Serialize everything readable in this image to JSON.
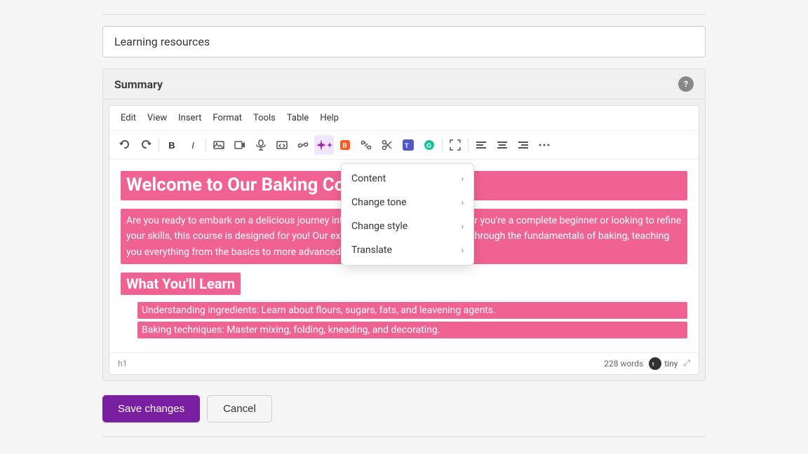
{
  "page": {
    "title": "Learning resources",
    "summary_label": "Summary",
    "help_icon": "?",
    "word_count": "228 words",
    "status_tag": "h1",
    "tiny_label": "tiny"
  },
  "menu_bar": {
    "items": [
      "Edit",
      "View",
      "Insert",
      "Format",
      "Tools",
      "Table",
      "Help"
    ]
  },
  "toolbar": {
    "undo_label": "↺",
    "redo_label": "↻",
    "bold_label": "B",
    "italic_label": "I"
  },
  "dropdown": {
    "header": "Content",
    "items": [
      {
        "label": "Change tone",
        "has_submenu": true
      },
      {
        "label": "Change style",
        "has_submenu": true
      },
      {
        "label": "Translate",
        "has_submenu": true
      }
    ]
  },
  "editor_content": {
    "heading": "Welcome to Our Baking Course!",
    "body_text": "Are you ready to embark on a delicious journey into the world of baking? Whether you're a complete beginner or looking to refine your skills, this course is designed for you! Our expert instructors will guide you through the fundamentals of baking, teaching you everything from the basics to more advanced techniques.",
    "subheading": "What You'll Learn",
    "list_items": [
      "Understanding ingredients: Learn about flours, sugars, fats, and leavening agents.",
      "Baking techniques: Master mixing, folding, kneading, and decorating."
    ]
  },
  "actions": {
    "save_label": "Save changes",
    "cancel_label": "Cancel"
  },
  "colors": {
    "highlight": "#f06292",
    "save_btn": "#7b1fa2"
  }
}
